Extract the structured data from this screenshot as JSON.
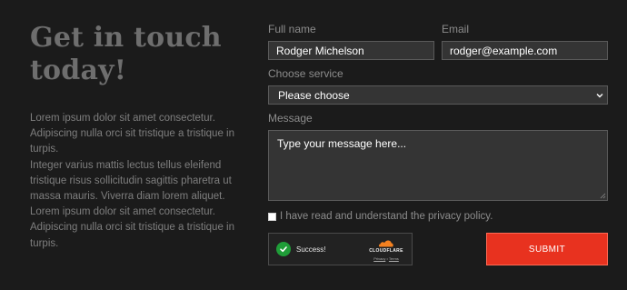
{
  "intro": {
    "heading_line1": "Get in touch",
    "heading_line2": "today!",
    "paragraph1": "Lorem ipsum dolor sit amet consectetur. Adipiscing nulla orci sit tristique a tristique in turpis.",
    "paragraph2": "Integer varius mattis lectus tellus eleifend tristique risus sollicitudin sagittis pharetra ut massa mauris. Viverra diam lorem aliquet. Lorem ipsum dolor sit amet consectetur. Adipiscing nulla orci sit tristique a tristique in turpis."
  },
  "form": {
    "full_name": {
      "label": "Full name",
      "value": "Rodger Michelson"
    },
    "email": {
      "label": "Email",
      "value": "rodger@example.com"
    },
    "service": {
      "label": "Choose service",
      "selected": "Please choose"
    },
    "message": {
      "label": "Message",
      "placeholder": "Type your message here..."
    },
    "privacy": {
      "label": "I have read and understand the privacy policy.",
      "checked": false
    },
    "captcha": {
      "status": "Success!",
      "brand": "CLOUDFLARE",
      "privacy_link": "Privacy",
      "separator": "•",
      "terms_link": "Terms"
    },
    "submit_label": "SUBMIT"
  },
  "colors": {
    "background": "#1b1b1b",
    "field_background": "#343434",
    "accent": "#e8321f",
    "success": "#1f9d38",
    "cloudflare_orange": "#f48120"
  },
  "icons": {
    "select": "chevron-down-icon",
    "captcha_status": "check-circle-icon",
    "captcha_brand": "cloudflare-logo-icon"
  }
}
